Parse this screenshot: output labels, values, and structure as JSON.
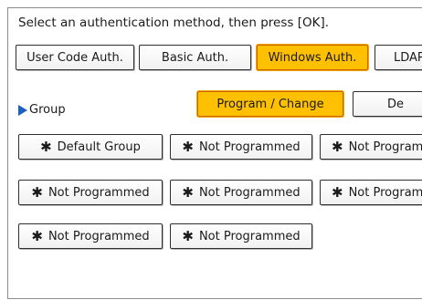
{
  "instruction": "Select an authentication method, then press [OK].",
  "auth_tabs": [
    {
      "label": "User Code Auth.",
      "selected": false
    },
    {
      "label": "Basic Auth.",
      "selected": false
    },
    {
      "label": "Windows Auth.",
      "selected": true
    },
    {
      "label": "LDAP",
      "selected": false
    }
  ],
  "group": {
    "label": "Group",
    "icon": "triangle-right-icon",
    "program_change_label": "Program / Change",
    "delete_label": "De"
  },
  "group_buttons": [
    "Default Group",
    "Not Programmed",
    "Not Program",
    "Not Programmed",
    "Not Programmed",
    "Not Program",
    "Not Programmed",
    "Not Programmed"
  ],
  "star_icon": "✱",
  "colors": {
    "selected": "#ffc000",
    "selected_border": "#c86400",
    "triangle": "#1f5fbf"
  }
}
